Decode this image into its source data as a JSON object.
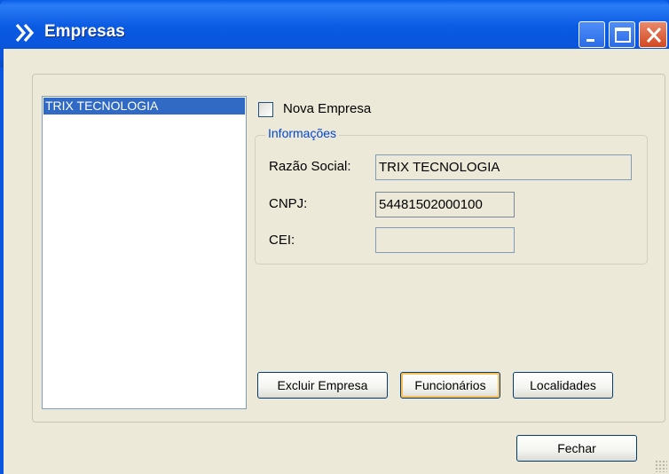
{
  "window": {
    "title": "Empresas"
  },
  "titlebar_buttons": {
    "minimize": "minimize",
    "maximize": "maximize",
    "close": "close"
  },
  "company_list": {
    "items": [
      "TRIX TECNOLOGIA"
    ],
    "selected": "TRIX TECNOLOGIA"
  },
  "nova_empresa": {
    "label": "Nova Empresa",
    "checked": false
  },
  "informacoes": {
    "group_title": "Informações",
    "razao_social": {
      "label": "Razão Social:",
      "value": "TRIX TECNOLOGIA"
    },
    "cnpj": {
      "label": "CNPJ:",
      "value": "54481502000100"
    },
    "cei": {
      "label": "CEI:",
      "value": ""
    }
  },
  "buttons": {
    "excluir": "Excluir Empresa",
    "funcionarios": "Funcionários",
    "localidades": "Localidades",
    "fechar": "Fechar"
  },
  "colors": {
    "title_bar": "#0a56e0",
    "selection": "#316ac5",
    "group_title": "#0046d5",
    "client_bg": "#ece9d8"
  }
}
